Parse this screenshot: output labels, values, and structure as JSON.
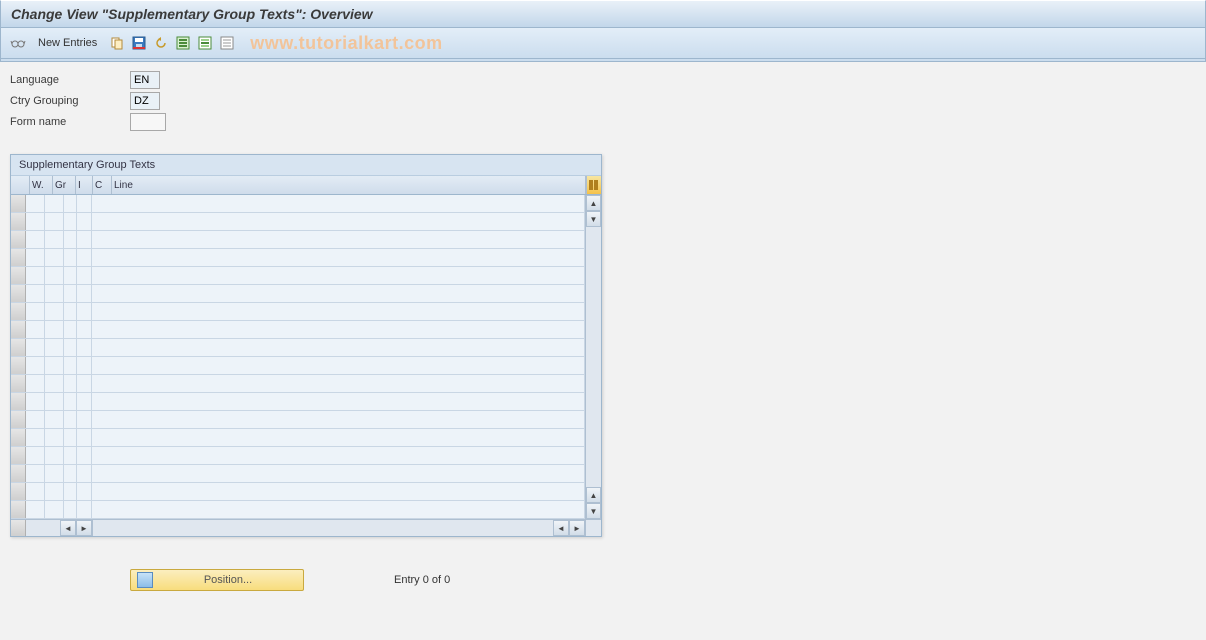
{
  "title": "Change View \"Supplementary Group Texts\": Overview",
  "toolbar": {
    "new_entries": "New Entries",
    "watermark": "www.tutorialkart.com"
  },
  "fields": {
    "language_label": "Language",
    "language_value": "EN",
    "ctry_label": "Ctry Grouping",
    "ctry_value": "DZ",
    "form_label": "Form name",
    "form_value": ""
  },
  "table": {
    "title": "Supplementary Group Texts",
    "cols": {
      "w": "W.",
      "gr": "Gr",
      "i": "I",
      "c": "C",
      "line": "Line"
    },
    "row_count": 18
  },
  "footer": {
    "position_label": "Position...",
    "entry_text": "Entry 0 of 0"
  }
}
